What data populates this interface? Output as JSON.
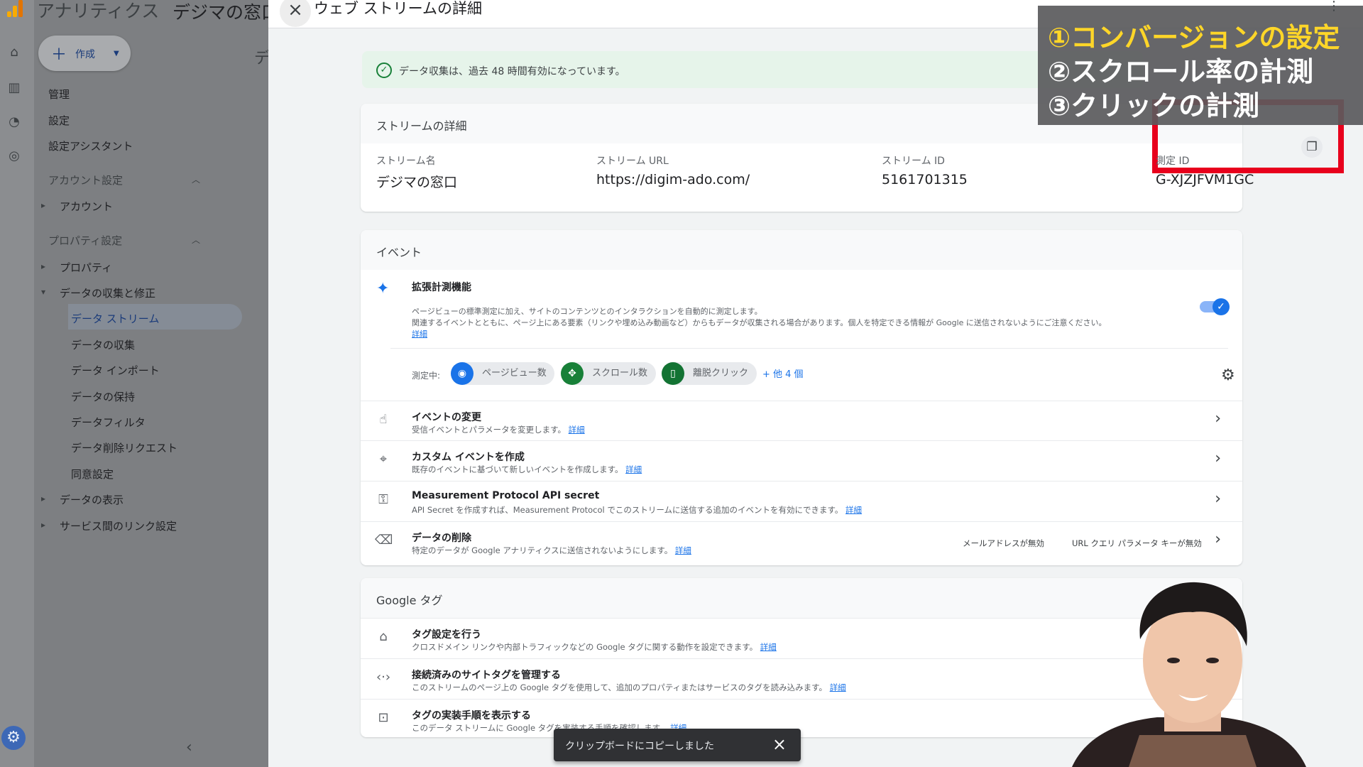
{
  "app": {
    "title": "アナリティクス",
    "property": "デジマの窓口"
  },
  "sidebar": {
    "create_label": "作成",
    "items_top": [
      "管理",
      "設定",
      "設定アシスタント"
    ],
    "account_section": "アカウント設定",
    "account_items": [
      "アカウント"
    ],
    "property_section": "プロパティ設定",
    "property_items": [
      "プロパティ",
      "データの収集と修正"
    ],
    "data_items": [
      "データ ストリーム",
      "データの収集",
      "データ インポート",
      "データの保持",
      "データフィルタ",
      "データ削除リクエスト",
      "同意設定"
    ],
    "bottom_items": [
      "データの表示",
      "サービス間のリンク設定"
    ],
    "selected": "データ ストリーム",
    "hidden_header_char": "デ"
  },
  "pane": {
    "title": "ウェブ ストリームの詳細",
    "banner": "データ収集は、過去 48 時間有効になっています。",
    "stream": {
      "header": "ストリームの詳細",
      "name_label": "ストリーム名",
      "name_value": "デジマの窓口",
      "url_label": "ストリーム URL",
      "url_value": "https://digim-ado.com/",
      "id_label": "ストリーム ID",
      "id_value": "5161701315",
      "mid_label": "測定 ID",
      "mid_value": "G-XJZJFVM1GC"
    },
    "events": {
      "header": "イベント",
      "enhanced_title": "拡張計測機能",
      "enhanced_desc1": "ページビューの標準測定に加え、サイトのコンテンツとのインタラクションを自動的に測定します。",
      "enhanced_desc2": "関連するイベントとともに、ページ上にある要素（リンクや埋め込み動画など）からもデータが収集される場合があります。個人を特定できる情報が Google に送信されないようにご注意ください。",
      "detail_link": "詳細",
      "measuring_label": "測定中:",
      "chips": [
        "ページビュー数",
        "スクロール数",
        "離脱クリック"
      ],
      "more": "+ 他 4 個",
      "toggle_on": true,
      "rows": [
        {
          "title": "イベントの変更",
          "desc": "受信イベントとパラメータを変更します。",
          "link": "詳細"
        },
        {
          "title": "カスタム イベントを作成",
          "desc": "既存のイベントに基づいて新しいイベントを作成します。",
          "link": "詳細"
        },
        {
          "title": "Measurement Protocol API secret",
          "desc": "API Secret を作成すれば、Measurement Protocol でこのストリームに送信する追加のイベントを有効にできます。",
          "link": "詳細"
        },
        {
          "title": "データの削除",
          "desc": "特定のデータが Google アナリティクスに送信されないようにします。",
          "link": "詳細",
          "status1": "メールアドレスが無効",
          "status2": "URL クエリ パラメータ キーが無効"
        }
      ]
    },
    "gtag": {
      "header": "Google タグ",
      "rows": [
        {
          "title": "タグ設定を行う",
          "desc": "クロスドメイン リンクや内部トラフィックなどの Google タグに関する動作を設定できます。",
          "link": "詳細"
        },
        {
          "title": "接続済みのサイトタグを管理する",
          "desc": "このストリームのページ上の Google タグを使用して、追加のプロパティまたはサービスのタグを読み込みます。",
          "link": "詳細"
        },
        {
          "title": "タグの実装手順を表示する",
          "desc": "このデータ ストリームに Google タグを実装する手順を確認します。",
          "link": "詳細"
        }
      ]
    }
  },
  "overlay": {
    "line1": "①コンバージョンの設定",
    "line2": "②スクロール率の計測",
    "line3": "③クリックの計測"
  },
  "toast": {
    "text": "クリップボードにコピーしました"
  },
  "icons": {
    "rail": [
      "home-icon",
      "reports-icon",
      "explore-icon",
      "advertising-icon"
    ],
    "events": [
      "sparkle-icon",
      "touch-icon",
      "cursor-click-icon",
      "key-icon",
      "eraser-icon"
    ],
    "gtag": [
      "tag-icon",
      "code-icon",
      "install-icon"
    ]
  },
  "colors": {
    "accent": "#1a73e8",
    "highlight_box": "#e8001c",
    "overlay_title": "#ffd628",
    "banner_bg": "#e6f4ea"
  }
}
